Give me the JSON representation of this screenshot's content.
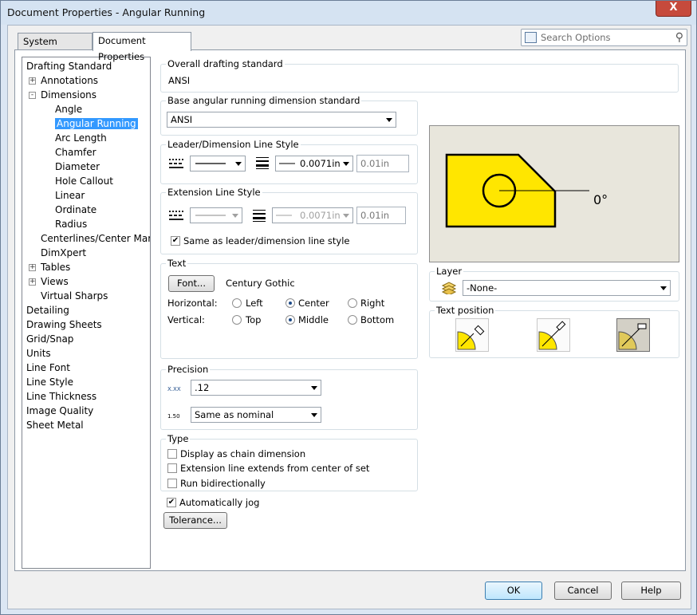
{
  "window": {
    "title": "Document Properties - Angular Running",
    "close_glyph": "X"
  },
  "tabs": [
    {
      "label": "System Options"
    },
    {
      "label": "Document Properties"
    }
  ],
  "search": {
    "placeholder": "Search Options"
  },
  "tree": [
    {
      "label": "Drafting Standard",
      "indent": 0
    },
    {
      "label": "Annotations",
      "indent": 1,
      "expander": "+"
    },
    {
      "label": "Dimensions",
      "indent": 1,
      "expander": "-"
    },
    {
      "label": "Angle",
      "indent": 2
    },
    {
      "label": "Angular Running",
      "indent": 2,
      "selected": true
    },
    {
      "label": "Arc Length",
      "indent": 2
    },
    {
      "label": "Chamfer",
      "indent": 2
    },
    {
      "label": "Diameter",
      "indent": 2
    },
    {
      "label": "Hole Callout",
      "indent": 2
    },
    {
      "label": "Linear",
      "indent": 2
    },
    {
      "label": "Ordinate",
      "indent": 2
    },
    {
      "label": "Radius",
      "indent": 2
    },
    {
      "label": "Centerlines/Center Marks",
      "indent": 1
    },
    {
      "label": "DimXpert",
      "indent": 1
    },
    {
      "label": "Tables",
      "indent": 1,
      "expander": "+"
    },
    {
      "label": "Views",
      "indent": 1,
      "expander": "+"
    },
    {
      "label": "Virtual Sharps",
      "indent": 1
    },
    {
      "label": "Detailing",
      "indent": 0
    },
    {
      "label": "Drawing Sheets",
      "indent": 0
    },
    {
      "label": "Grid/Snap",
      "indent": 0
    },
    {
      "label": "Units",
      "indent": 0
    },
    {
      "label": "Line Font",
      "indent": 0
    },
    {
      "label": "Line Style",
      "indent": 0
    },
    {
      "label": "Line Thickness",
      "indent": 0
    },
    {
      "label": "Image Quality",
      "indent": 0
    },
    {
      "label": "Sheet Metal",
      "indent": 0
    }
  ],
  "overall": {
    "label": "Overall drafting standard",
    "value": "ANSI"
  },
  "base": {
    "label": "Base angular running dimension standard",
    "value": "ANSI"
  },
  "leader": {
    "label": "Leader/Dimension Line Style",
    "thickness": "0.0071in",
    "custom": "0.01in"
  },
  "extension": {
    "label": "Extension Line Style",
    "thickness": "0.0071in",
    "custom": "0.01in",
    "same_as_label": "Same as leader/dimension line style"
  },
  "text": {
    "label": "Text",
    "font_button": "Font...",
    "font_name": "Century Gothic",
    "horizontal_label": "Horizontal:",
    "vertical_label": "Vertical:",
    "h_options": [
      "Left",
      "Center",
      "Right"
    ],
    "h_selected": "Center",
    "v_options": [
      "Top",
      "Middle",
      "Bottom"
    ],
    "v_selected": "Middle"
  },
  "precision": {
    "label": "Precision",
    "primary": ".12",
    "tolerance": "Same as nominal",
    "icon1_text": "X.XX",
    "icon2_text": "1.50"
  },
  "type": {
    "label": "Type",
    "options": [
      {
        "label": "Display as chain dimension",
        "checked": false
      },
      {
        "label": "Extension line extends from center of set",
        "checked": false
      },
      {
        "label": "Run bidirectionally",
        "checked": false
      }
    ]
  },
  "auto_jog": {
    "label": "Automatically jog",
    "checked": true
  },
  "tolerance_button": "Tolerance...",
  "preview": {
    "dimension_text": "0°"
  },
  "layer": {
    "label": "Layer",
    "value": "-None-"
  },
  "text_position": {
    "label": "Text position",
    "selected_index": 2
  },
  "footer": {
    "ok": "OK",
    "cancel": "Cancel",
    "help": "Help"
  },
  "colors": {
    "selection": "#3399ff",
    "preview_part": "#ffe600",
    "preview_bg": "#e8e6dc"
  }
}
